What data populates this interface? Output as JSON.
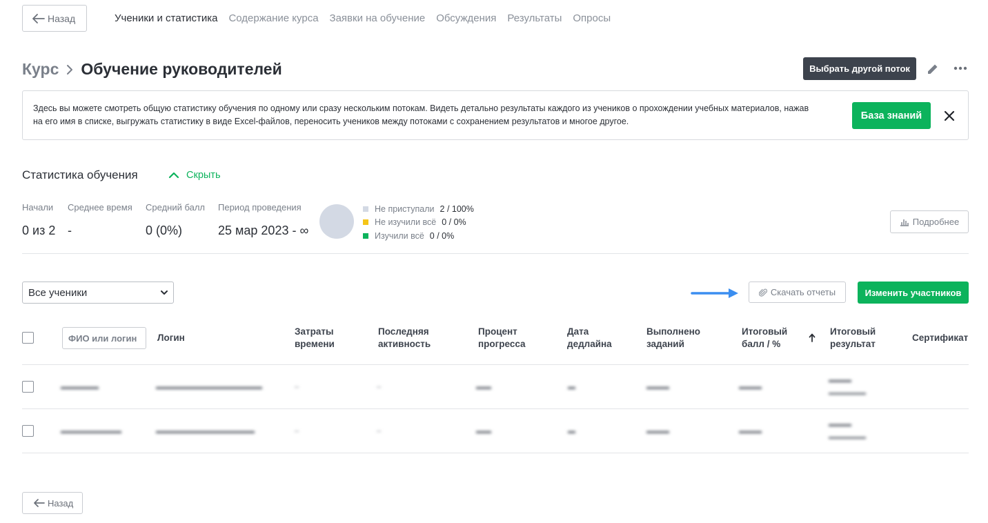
{
  "nav": {
    "back_label": "Назад",
    "tabs": [
      {
        "label": "Ученики и статистика",
        "active": true
      },
      {
        "label": "Содержание курса",
        "active": false
      },
      {
        "label": "Заявки на обучение",
        "active": false
      },
      {
        "label": "Обсуждения",
        "active": false
      },
      {
        "label": "Результаты",
        "active": false
      },
      {
        "label": "Опросы",
        "active": false
      }
    ]
  },
  "header": {
    "breadcrumb_root": "Курс",
    "title": "Обучение руководителей",
    "switch_stream_label": "Выбрать другой поток"
  },
  "banner": {
    "text": "Здесь вы можете смотреть общую статистику обучения по одному или сразу нескольким потокам. Видеть детально результаты каждого из учеников о прохождении учебных материалов, нажав на его имя в списке, выгружать статистику в виде Excel-файлов, переносить учеников между потоками с сохранением результатов и многое другое.",
    "knowledge_base_label": "База знаний"
  },
  "stats": {
    "title": "Статистика обучения",
    "toggle_label": "Скрыть",
    "items": [
      {
        "label": "Начали",
        "value": "0 из 2"
      },
      {
        "label": "Среднее время",
        "value": "-"
      },
      {
        "label": "Средний балл",
        "value": "0 (0%)"
      },
      {
        "label": "Период проведения",
        "value": "25 мар 2023 - ∞"
      }
    ],
    "legend": [
      {
        "label": "Не приступали",
        "value": "2 / 100%",
        "color": "#d3d9e4"
      },
      {
        "label": "Не изучили всё",
        "value": "0 / 0%",
        "color": "#f5c518"
      },
      {
        "label": "Изучили всё",
        "value": "0 / 0%",
        "color": "#0cb35c"
      }
    ],
    "details_label": "Подробнее"
  },
  "filters": {
    "select_value": "Все ученики",
    "download_label": "Скачать отчеты",
    "change_participants_label": "Изменить участников"
  },
  "table": {
    "search_placeholder": "ФИО или логин",
    "headers": {
      "login": "Логин",
      "time": [
        "Затраты",
        "времени"
      ],
      "activity": [
        "Последняя",
        "активность"
      ],
      "progress": [
        "Процент",
        "прогресса"
      ],
      "deadline": [
        "Дата",
        "дедлайна"
      ],
      "done": [
        "Выполнено",
        "заданий"
      ],
      "score": [
        "Итоговый",
        "балл / %"
      ],
      "result": [
        "Итоговый",
        "результат"
      ],
      "certificate": "Сертификат"
    }
  },
  "footer": {
    "back_label": "Назад"
  },
  "colors": {
    "accent": "#0cb35c",
    "dark_button": "#3d434d",
    "annotation_arrow": "#3b8ef0"
  }
}
